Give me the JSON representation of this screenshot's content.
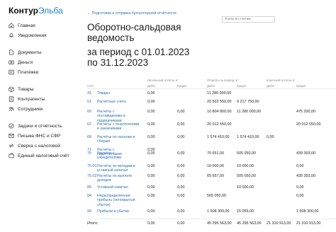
{
  "app": {
    "logo_brand": "Контур",
    "logo_product": "Эльба"
  },
  "sidebar": {
    "items": [
      {
        "label": "Главная",
        "icon": "home-icon"
      },
      {
        "label": "Уведомления",
        "icon": "bell-icon"
      },
      {
        "label": "Документы",
        "icon": "document-icon"
      },
      {
        "label": "Деньги",
        "icon": "money-icon"
      },
      {
        "label": "Платёжки",
        "icon": "payment-icon"
      },
      {
        "label": "Товары",
        "icon": "box-icon"
      },
      {
        "label": "Контрагенты",
        "icon": "contractors-icon"
      },
      {
        "label": "Сотрудники",
        "icon": "employees-icon"
      },
      {
        "label": "Задачи и отчётность",
        "icon": "tasks-icon"
      },
      {
        "label": "Письма ФНС и СФР",
        "icon": "mail-icon"
      },
      {
        "label": "Сверка с налоговой",
        "icon": "reconcile-icon"
      },
      {
        "label": "Единый налоговый счёт",
        "icon": "tax-account-icon"
      }
    ]
  },
  "breadcrumb": "← Подготовка и отправка бухгалтерской отчётности",
  "search": {
    "placeholder": "Поиск по счетам"
  },
  "title": {
    "line1": "Оборотно-сальдовая",
    "line2": "ведомость",
    "line3": "за период с 01.01.2023",
    "line4": "по 31.12.2023"
  },
  "table": {
    "group_headers": {
      "opening": "Начальный остаток, ₽",
      "turnover": "Обороты за период, ₽",
      "closing": "Конечный остаток, ₽"
    },
    "sub_headers": {
      "account": "Счёт",
      "debit1": "Дебет",
      "credit1": "Кредит",
      "debit2": "Дебет",
      "credit2": "Кредит",
      "debit3": "Дебет",
      "credit3": "Кредит"
    },
    "rows": [
      {
        "account": "41",
        "name": "Товары",
        "od": "0,00",
        "oc": "",
        "td": "11 280 000,00",
        "tc": "",
        "cd": "",
        "cc": ""
      },
      {
        "account": "51",
        "name": "Расчётные счета",
        "od": "0,00",
        "oc": "",
        "td": "20 502 550,00",
        "tc": "9 217 750,00",
        "cd": "",
        "cc": ""
      },
      {
        "account": "60",
        "name": "Расчёты с поставщиками и подрядчиками",
        "od": "0,00",
        "oc": "0,00",
        "td": "10 804 800,00",
        "tc": "11 280 000,00",
        "cd": "",
        "cc": "475 200,00"
      },
      {
        "account": "62",
        "name": "Расчёты с покупателями и заказчиками",
        "od": "0,00",
        "oc": "0,00",
        "td": "20 012 550,00",
        "tc": "",
        "cd": "",
        "cc": "20 012 550,00"
      },
      {
        "account": "68",
        "name": "Расчёты по налогам и сборам",
        "od": "0,00",
        "oc": "0,00",
        "td": "1 574 410,00",
        "tc": "1 574 410,00",
        "cd": "0,00",
        "cc": ""
      },
      {
        "account": "71",
        "name": "Расчёты с подотчётными",
        "od": "0,00",
        "oc": "",
        "td": "",
        "tc": "",
        "cd": "",
        "cc": ""
      },
      {
        "account": "75",
        "name": "Расчёты с учредителями",
        "od": "0,00",
        "oc": "0,00",
        "td": "75 651,00",
        "tc": "505 050,00",
        "cd": "",
        "cc": "439 393,00"
      },
      {
        "account": "75.01",
        "name": "Расчёты по вкладам в уставный капитал",
        "od": "0,00",
        "oc": "0,00",
        "td": "10 000,00",
        "tc": "10 000,00",
        "cd": "",
        "cc": "0,00"
      },
      {
        "account": "75.02",
        "name": "Расчёты по выплате доходов",
        "od": "0,00",
        "oc": "0,00",
        "td": "65 657,00",
        "tc": "505 050,00",
        "cd": "",
        "cc": "439 393,00"
      },
      {
        "account": "80",
        "name": "Уставный капитал",
        "od": "0,00",
        "oc": "0,00",
        "td": "",
        "tc": "10 000,00",
        "cd": "",
        "cc": "0,00"
      },
      {
        "account": "84",
        "name": "Нераспределённая прибыль (непокрытый убыток)",
        "od": "0,00",
        "oc": "0,00",
        "td": "505 050,00",
        "tc": "",
        "cd": "",
        "cc": "0,00"
      },
      {
        "account": "99",
        "name": "Прибыли и убытки",
        "od": "0,00",
        "oc": "0,00",
        "td": "1 008 300,00",
        "tc": "15 055,00",
        "cd": "",
        "cc": "1 508 300,00"
      }
    ],
    "total": {
      "label": "Итого:",
      "od": "0,00",
      "oc": "0,00",
      "td": "45 295 563,00",
      "tc": "45 295 563,00",
      "cd": "21 310 913,00",
      "cc": "21 310 913,00"
    }
  }
}
